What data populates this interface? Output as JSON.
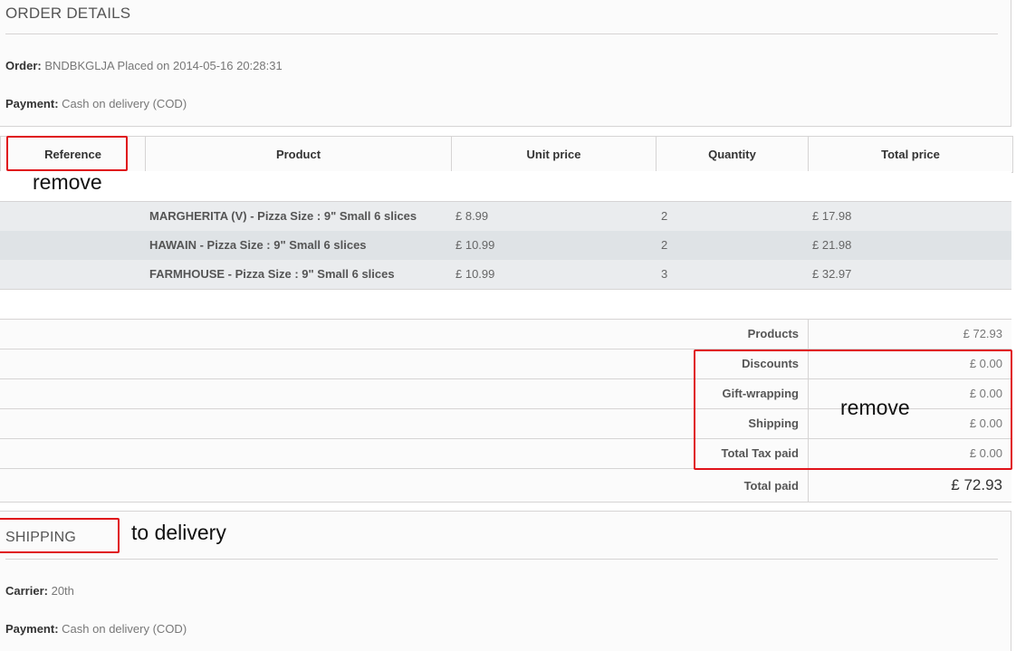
{
  "order_details": {
    "title": "ORDER DETAILS",
    "order_label": "Order:",
    "order_value": "BNDBKGLJA Placed on 2014-05-16 20:28:31",
    "payment_label": "Payment:",
    "payment_value": "Cash on delivery (COD)"
  },
  "table": {
    "headers": [
      "Reference",
      "Product",
      "Unit price",
      "Quantity",
      "Total price"
    ],
    "rows": [
      {
        "product": "MARGHERITA (V) - Pizza Size : 9\" Small 6 slices",
        "unit": "£ 8.99",
        "qty": "2",
        "total": "£ 17.98"
      },
      {
        "product": "HAWAIN - Pizza Size : 9\" Small 6 slices",
        "unit": "£ 10.99",
        "qty": "2",
        "total": "£ 21.98"
      },
      {
        "product": "FARMHOUSE - Pizza Size : 9\" Small 6 slices",
        "unit": "£ 10.99",
        "qty": "3",
        "total": "£ 32.97"
      }
    ]
  },
  "summary": [
    {
      "label": "Products",
      "value": "£ 72.93"
    },
    {
      "label": "Discounts",
      "value": "£ 0.00"
    },
    {
      "label": "Gift-wrapping",
      "value": "£ 0.00"
    },
    {
      "label": "Shipping",
      "value": "£ 0.00"
    },
    {
      "label": "Total Tax paid",
      "value": "£ 0.00"
    },
    {
      "label": "Total paid",
      "value": "£ 72.93"
    }
  ],
  "shipping": {
    "title": "SHIPPING",
    "carrier_label": "Carrier:",
    "carrier_value": "20th",
    "payment_label": "Payment:",
    "payment_value": "Cash on delivery (COD)"
  },
  "annotations": {
    "remove_reference": "remove",
    "remove_summary": "remove",
    "to_delivery": "to delivery"
  },
  "colors": {
    "annotation_red": "#e0121a",
    "row_light": "#eaecee",
    "row_dark": "#dfe3e6",
    "border": "#d6d4d4"
  }
}
